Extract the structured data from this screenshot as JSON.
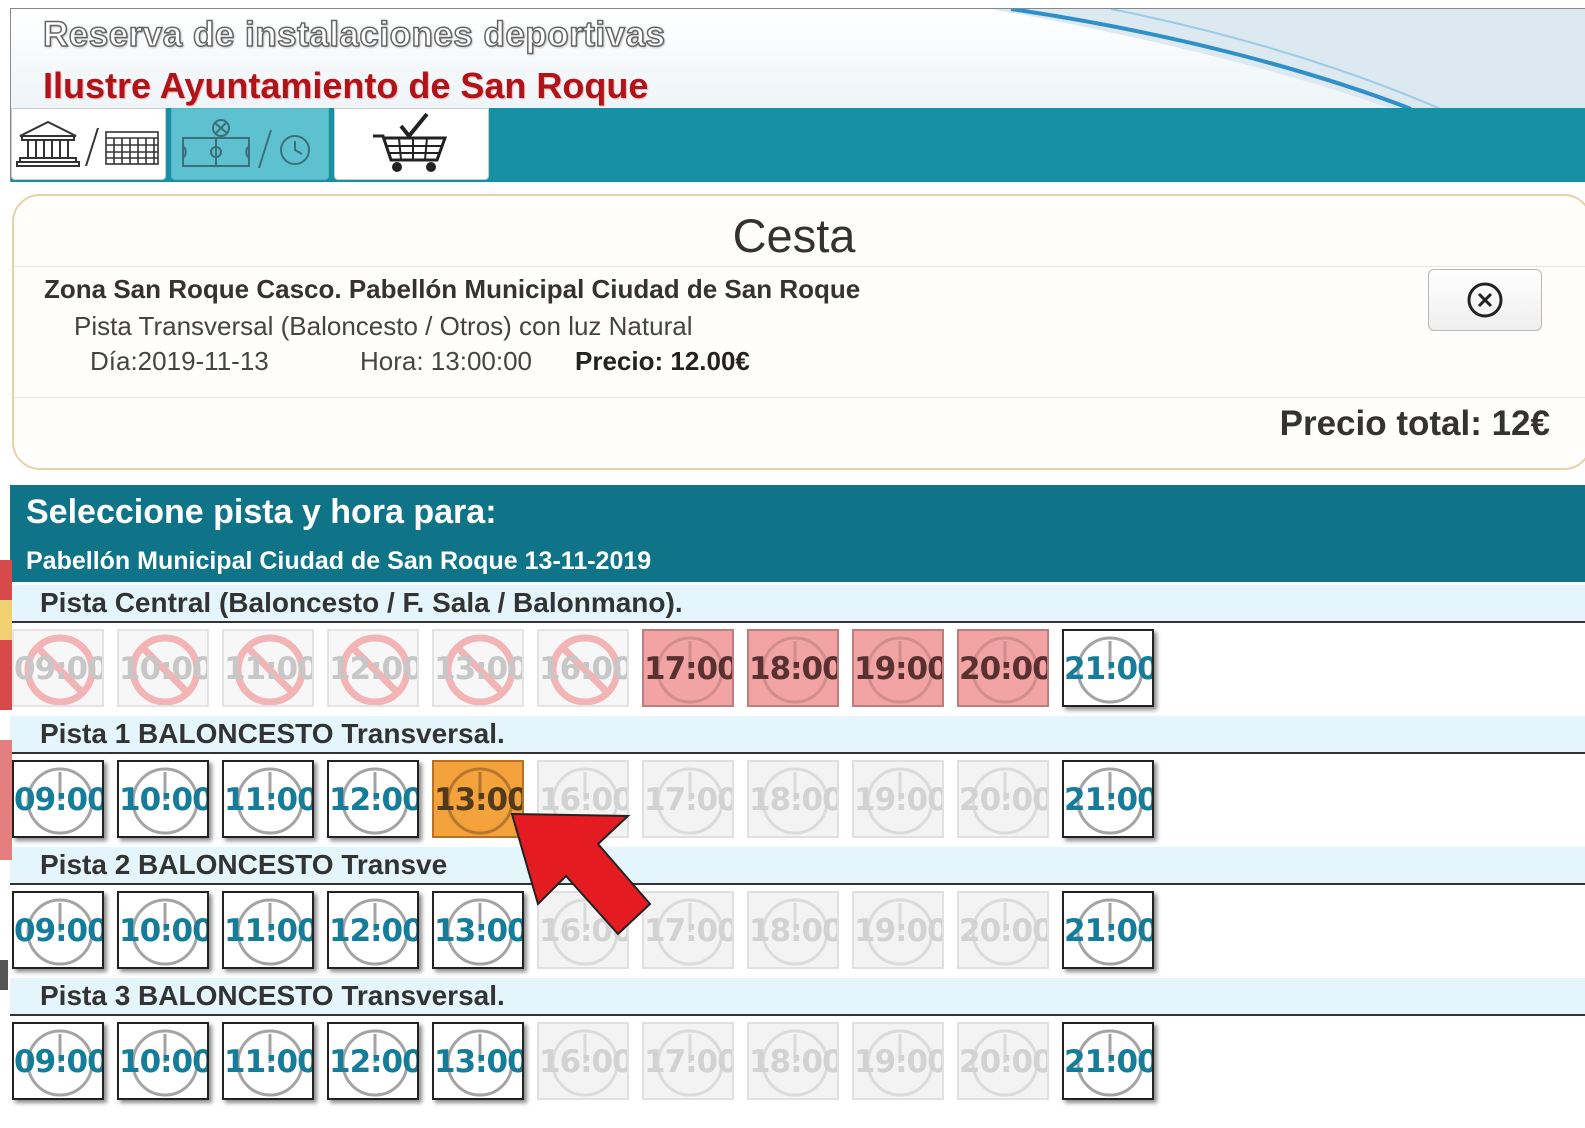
{
  "header": {
    "title": "Reserva de instalaciones deportivas",
    "subtitle": "Ilustre Ayuntamiento de San Roque"
  },
  "toolbar": {
    "buttons": [
      {
        "name": "facility-date-step",
        "icons": [
          "building-icon",
          "calendar-icon"
        ],
        "active": false
      },
      {
        "name": "court-time-step",
        "icons": [
          "courts-icon",
          "clock-icon"
        ],
        "active": true
      },
      {
        "name": "cart-step",
        "icons": [
          "cart-check-icon"
        ],
        "active": false
      }
    ]
  },
  "cesta": {
    "title": "Cesta",
    "zona": "Zona San Roque Casco. Pabellón Municipal Ciudad de San Roque",
    "pista": "Pista Transversal (Baloncesto / Otros) con luz Natural",
    "dia": "Día:2019-11-13",
    "hora": "Hora: 13:00:00",
    "precio": "Precio: 12.00€",
    "total": "Precio total: 12€"
  },
  "select": {
    "title": "Seleccione pista y hora para:",
    "subtitle": "Pabellón Municipal Ciudad de San Roque 13-11-2019"
  },
  "pistas": [
    {
      "label": "Pista Central (Baloncesto / F. Sala / Balonmano).",
      "slots": [
        {
          "time": "09:00",
          "state": "blocked"
        },
        {
          "time": "10:00",
          "state": "blocked"
        },
        {
          "time": "11:00",
          "state": "blocked"
        },
        {
          "time": "12:00",
          "state": "blocked"
        },
        {
          "time": "13:00",
          "state": "blocked"
        },
        {
          "time": "16:00",
          "state": "blocked"
        },
        {
          "time": "17:00",
          "state": "occupied"
        },
        {
          "time": "18:00",
          "state": "occupied"
        },
        {
          "time": "19:00",
          "state": "occupied"
        },
        {
          "time": "20:00",
          "state": "occupied"
        },
        {
          "time": "21:00",
          "state": "available"
        }
      ]
    },
    {
      "label": "Pista 1 BALONCESTO Transversal.",
      "slots": [
        {
          "time": "09:00",
          "state": "available"
        },
        {
          "time": "10:00",
          "state": "available"
        },
        {
          "time": "11:00",
          "state": "available"
        },
        {
          "time": "12:00",
          "state": "available"
        },
        {
          "time": "13:00",
          "state": "selected"
        },
        {
          "time": "16:00",
          "state": "disabled"
        },
        {
          "time": "17:00",
          "state": "disabled"
        },
        {
          "time": "18:00",
          "state": "disabled"
        },
        {
          "time": "19:00",
          "state": "disabled"
        },
        {
          "time": "20:00",
          "state": "disabled"
        },
        {
          "time": "21:00",
          "state": "available"
        }
      ]
    },
    {
      "label": "Pista 2 BALONCESTO Transve",
      "slots": [
        {
          "time": "09:00",
          "state": "available"
        },
        {
          "time": "10:00",
          "state": "available"
        },
        {
          "time": "11:00",
          "state": "available"
        },
        {
          "time": "12:00",
          "state": "available"
        },
        {
          "time": "13:00",
          "state": "available"
        },
        {
          "time": "16:00",
          "state": "disabled"
        },
        {
          "time": "17:00",
          "state": "disabled"
        },
        {
          "time": "18:00",
          "state": "disabled"
        },
        {
          "time": "19:00",
          "state": "disabled"
        },
        {
          "time": "20:00",
          "state": "disabled"
        },
        {
          "time": "21:00",
          "state": "available"
        }
      ]
    },
    {
      "label": "Pista 3 BALONCESTO Transversal.",
      "slots": [
        {
          "time": "09:00",
          "state": "available"
        },
        {
          "time": "10:00",
          "state": "available"
        },
        {
          "time": "11:00",
          "state": "available"
        },
        {
          "time": "12:00",
          "state": "available"
        },
        {
          "time": "13:00",
          "state": "available"
        },
        {
          "time": "16:00",
          "state": "disabled"
        },
        {
          "time": "17:00",
          "state": "disabled"
        },
        {
          "time": "18:00",
          "state": "disabled"
        },
        {
          "time": "19:00",
          "state": "disabled"
        },
        {
          "time": "20:00",
          "state": "disabled"
        },
        {
          "time": "21:00",
          "state": "available"
        }
      ]
    }
  ],
  "colors": {
    "teal": "#178fa5",
    "dark_teal": "#0f7488",
    "slot_text": "#157d99",
    "selected": "#f4a23c",
    "occupied": "#f2a3a3",
    "arrow": "#e41c22"
  },
  "overlay": {
    "icon": "red-arrow-pointer-icon"
  }
}
